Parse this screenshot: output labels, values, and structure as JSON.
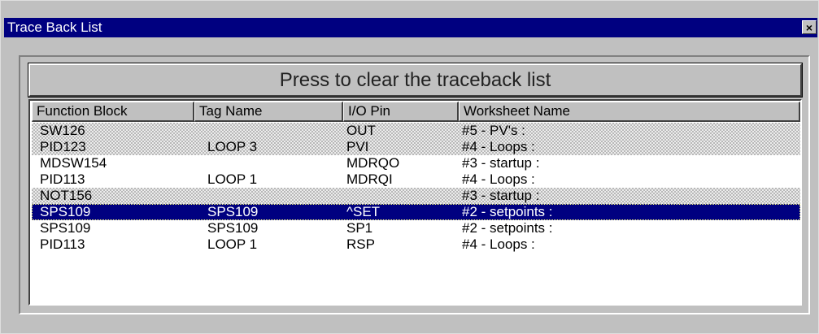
{
  "window": {
    "title": "Trace Back List",
    "close_label": "×"
  },
  "clear_button": {
    "label": "Press to clear the traceback list"
  },
  "table": {
    "columns": [
      "Function Block",
      "Tag Name",
      "I/O Pin",
      "Worksheet Name"
    ],
    "rows": [
      {
        "function_block": "SW126",
        "tag_name": "",
        "io_pin": "OUT",
        "worksheet": "#5 - PV's :",
        "style": "dotted"
      },
      {
        "function_block": "PID123",
        "tag_name": "LOOP 3",
        "io_pin": "PVI",
        "worksheet": "#4 - Loops :",
        "style": "dotted"
      },
      {
        "function_block": "MDSW154",
        "tag_name": "",
        "io_pin": "MDRQO",
        "worksheet": "#3 - startup :",
        "style": "normal"
      },
      {
        "function_block": "PID113",
        "tag_name": "LOOP 1",
        "io_pin": "MDRQI",
        "worksheet": "#4 - Loops :",
        "style": "normal"
      },
      {
        "function_block": "NOT156",
        "tag_name": "",
        "io_pin": "",
        "worksheet": "#3 - startup :",
        "style": "dotted"
      },
      {
        "function_block": "SPS109",
        "tag_name": "SPS109",
        "io_pin": "^SET",
        "worksheet": "#2 - setpoints :",
        "style": "selected"
      },
      {
        "function_block": "SPS109",
        "tag_name": "SPS109",
        "io_pin": "SP1",
        "worksheet": "#2 - setpoints :",
        "style": "normal"
      },
      {
        "function_block": "PID113",
        "tag_name": "LOOP 1",
        "io_pin": "RSP",
        "worksheet": "#4 - Loops :",
        "style": "normal"
      }
    ]
  },
  "colors": {
    "titlebar": "#000080",
    "selection": "#000080",
    "face": "#c0c0c0"
  }
}
